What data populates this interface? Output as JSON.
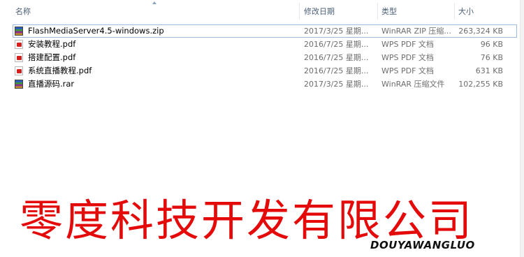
{
  "columns": {
    "name": "名称",
    "modified": "修改日期",
    "type": "类型",
    "size": "大小"
  },
  "files": [
    {
      "name": "FlashMediaServer4.5-windows.zip",
      "modified": "2017/3/25 星期...",
      "type": "WinRAR ZIP 压缩...",
      "size": "263,324 KB",
      "icon": "winrar-zip-icon",
      "focused": true
    },
    {
      "name": "安装教程.pdf",
      "modified": "2016/7/25 星期...",
      "type": "WPS PDF 文档",
      "size": "96 KB",
      "icon": "pdf-icon"
    },
    {
      "name": "搭建配置.pdf",
      "modified": "2016/7/25 星期...",
      "type": "WPS PDF 文档",
      "size": "76 KB",
      "icon": "pdf-icon"
    },
    {
      "name": "系统直播教程.pdf",
      "modified": "2016/7/25 星期...",
      "type": "WPS PDF 文档",
      "size": "631 KB",
      "icon": "pdf-icon"
    },
    {
      "name": "直播源码.rar",
      "modified": "2017/3/25 星期...",
      "type": "WinRAR 压缩文件",
      "size": "102,255 KB",
      "icon": "winrar-rar-icon"
    }
  ],
  "overlay": {
    "company": "零度科技开发有限公司",
    "brand": "DOUYAWANGLUO"
  },
  "colors": {
    "company_text": "#e40a0a",
    "focus_outline": "#9dbbe0",
    "header_text": "#4c607a"
  }
}
